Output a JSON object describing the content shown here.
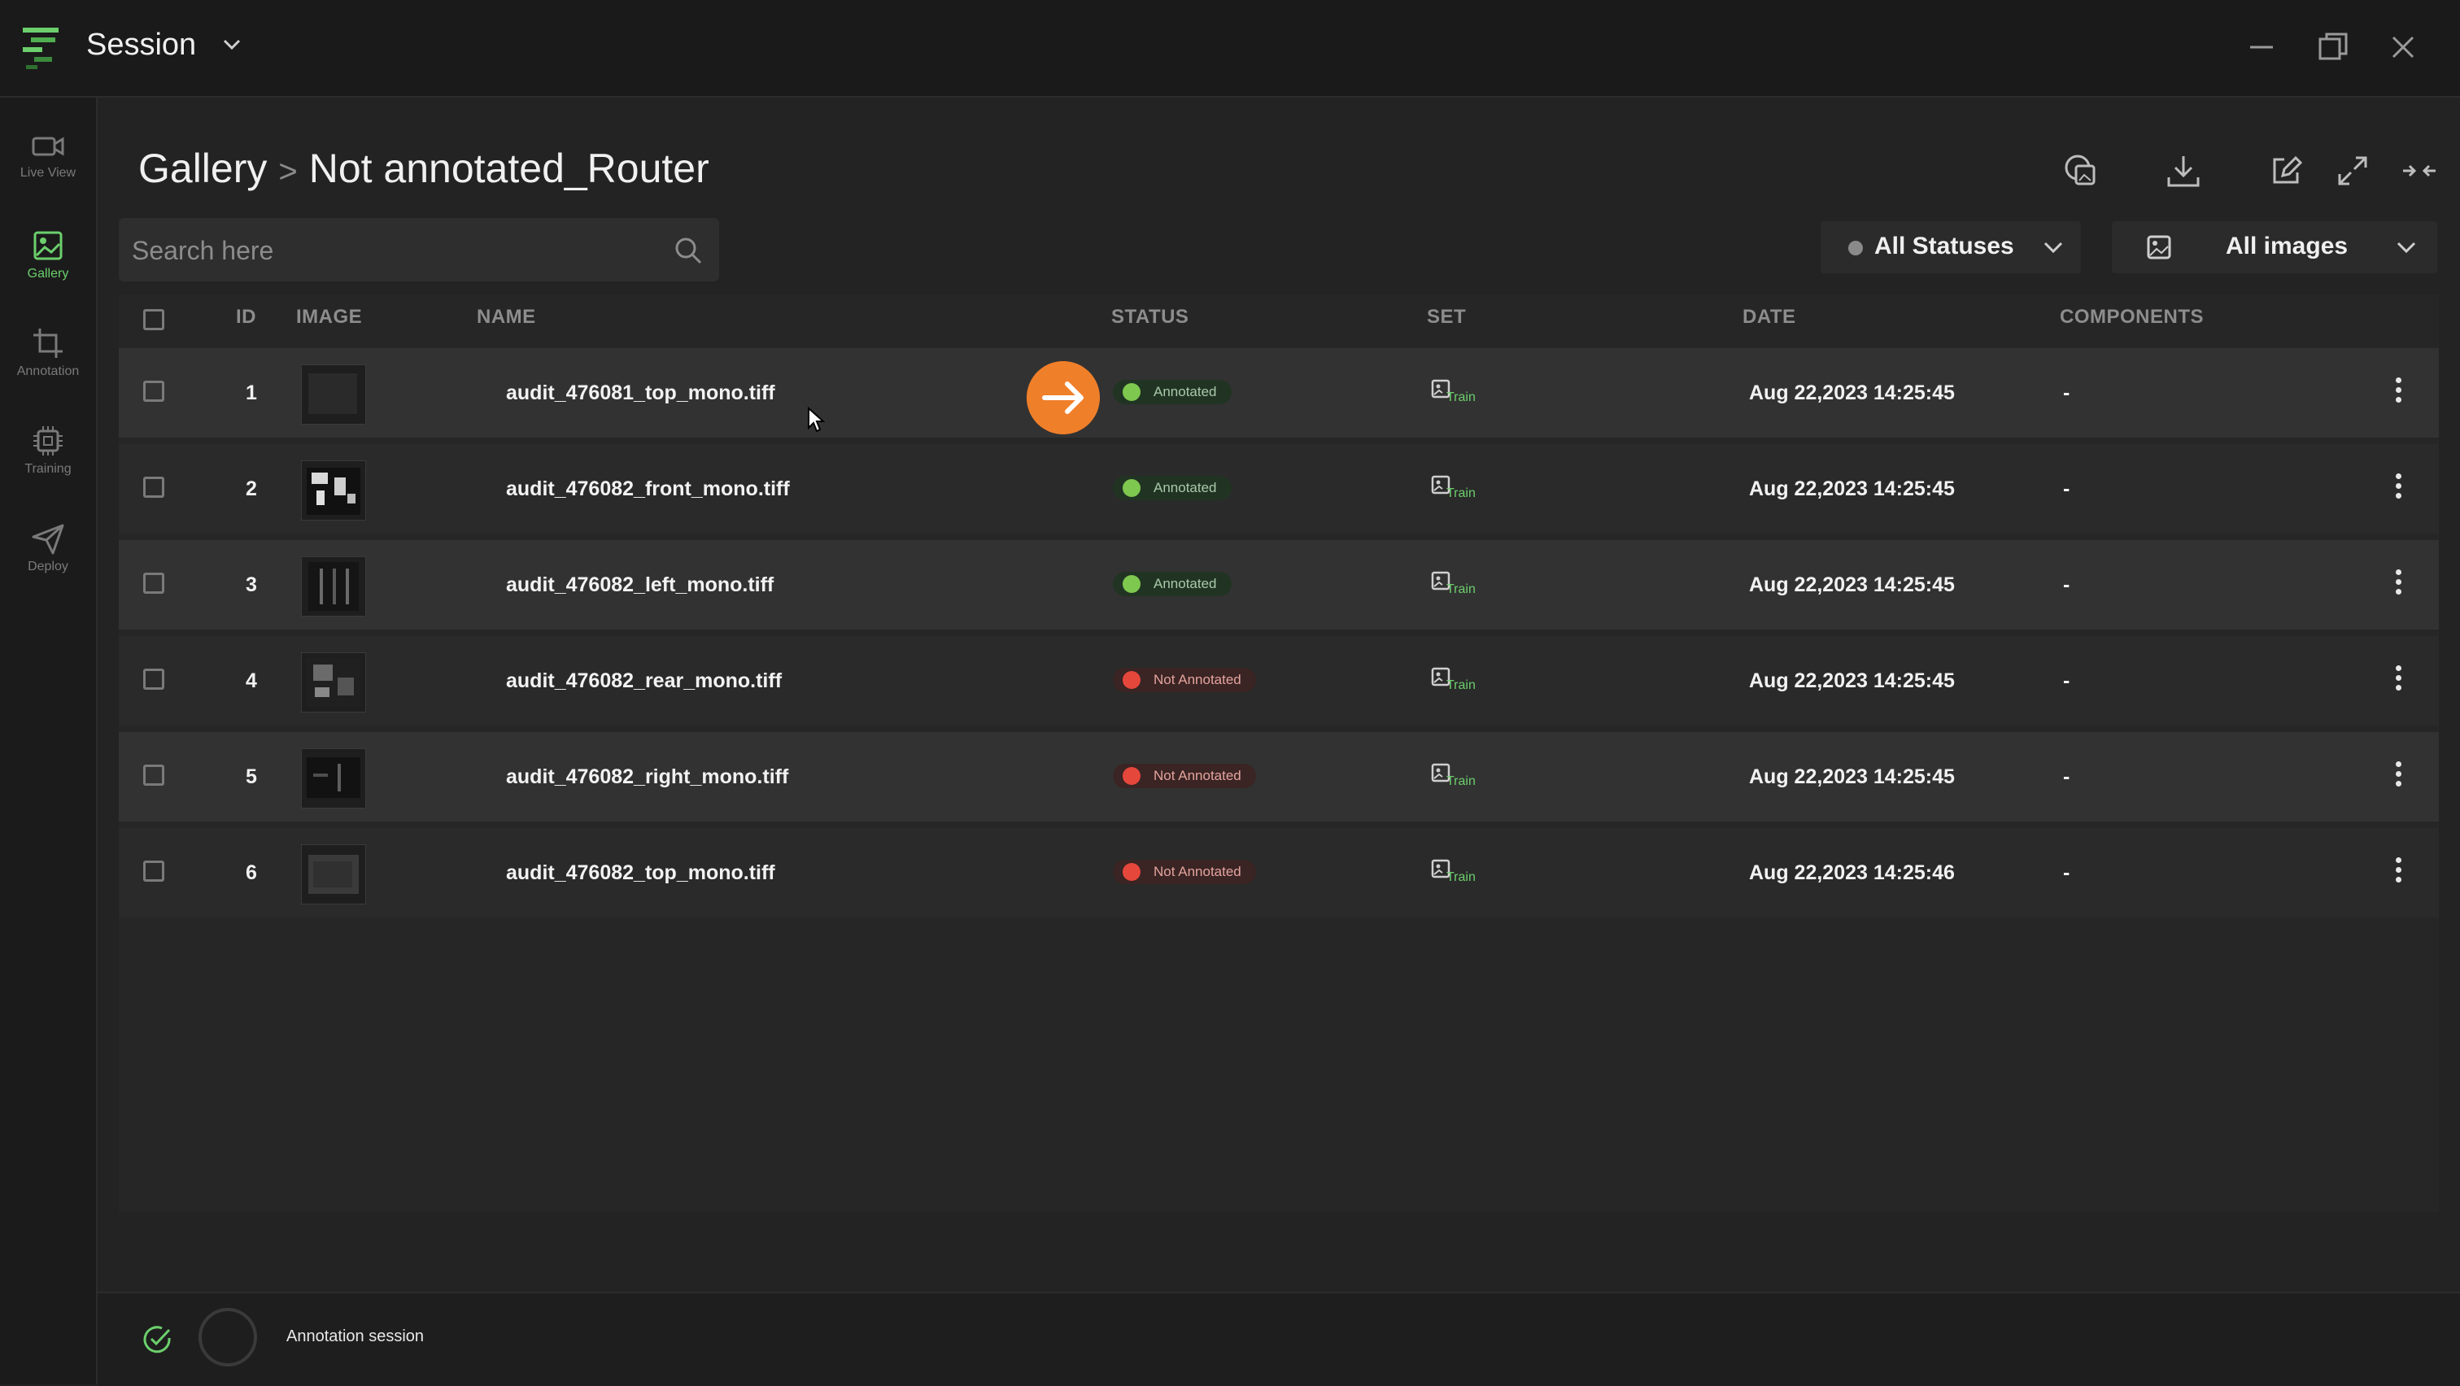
{
  "app": {
    "title": "Session"
  },
  "sidebar": {
    "items": [
      {
        "label": "Live View",
        "icon": "video-camera-icon",
        "active": false
      },
      {
        "label": "Gallery",
        "icon": "image-icon",
        "active": true
      },
      {
        "label": "Annotation",
        "icon": "crop-icon",
        "active": false
      },
      {
        "label": "Training",
        "icon": "cpu-chip-icon",
        "active": false
      },
      {
        "label": "Deploy",
        "icon": "paper-plane-icon",
        "active": false
      }
    ]
  },
  "header": {
    "breadcrumb_root": "Gallery",
    "breadcrumb_sep": ">",
    "breadcrumb_current": "Not annotated_Router",
    "actions": [
      "copy-image-icon",
      "download-icon",
      "edit-icon",
      "expand-icon",
      "collapse-icon"
    ]
  },
  "search": {
    "placeholder": "Search here",
    "value": ""
  },
  "filters": {
    "status_label": "All Statuses",
    "images_label": "All images"
  },
  "table": {
    "columns": [
      "ID",
      "IMAGE",
      "NAME",
      "STATUS",
      "SET",
      "DATE",
      "COMPONENTS"
    ],
    "rows": [
      {
        "id": "1",
        "name": "audit_476081_top_mono.tiff",
        "status": "Annotated",
        "set": "Train",
        "date": "Aug 22,2023 14:25:45",
        "components": "-"
      },
      {
        "id": "2",
        "name": "audit_476082_front_mono.tiff",
        "status": "Annotated",
        "set": "Train",
        "date": "Aug 22,2023 14:25:45",
        "components": "-"
      },
      {
        "id": "3",
        "name": "audit_476082_left_mono.tiff",
        "status": "Annotated",
        "set": "Train",
        "date": "Aug 22,2023 14:25:45",
        "components": "-"
      },
      {
        "id": "4",
        "name": "audit_476082_rear_mono.tiff",
        "status": "Not Annotated",
        "set": "Train",
        "date": "Aug 22,2023 14:25:45",
        "components": "-"
      },
      {
        "id": "5",
        "name": "audit_476082_right_mono.tiff",
        "status": "Not Annotated",
        "set": "Train",
        "date": "Aug 22,2023 14:25:45",
        "components": "-"
      },
      {
        "id": "6",
        "name": "audit_476082_top_mono.tiff",
        "status": "Not Annotated",
        "set": "Train",
        "date": "Aug 22,2023 14:25:46",
        "components": "-"
      }
    ]
  },
  "footer": {
    "label": "Annotation session"
  },
  "colors": {
    "accent_green": "#6ccf6c",
    "annotated_dot": "#7ec850",
    "not_annotated_dot": "#e5473b",
    "arrow_orange": "#f07f2a"
  }
}
